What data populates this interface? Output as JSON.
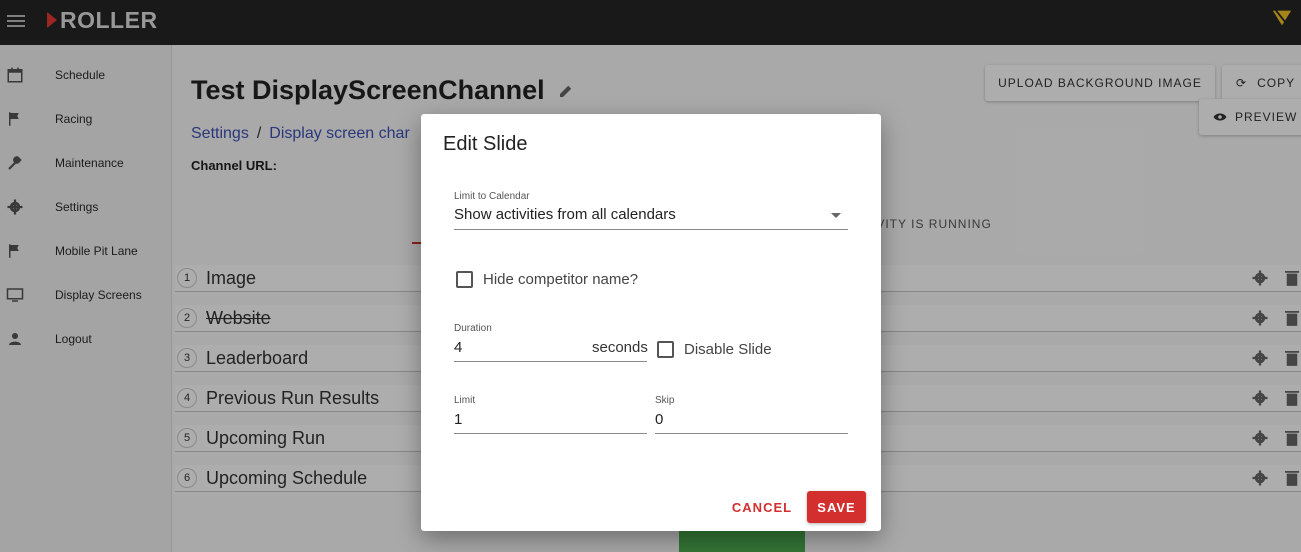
{
  "app": {
    "brand": "ROLLER",
    "accent": "#d32f2f"
  },
  "sidebar": {
    "items": [
      {
        "label": "Schedule",
        "icon": "calendar-icon"
      },
      {
        "label": "Racing",
        "icon": "flag-icon"
      },
      {
        "label": "Maintenance",
        "icon": "wrench-icon"
      },
      {
        "label": "Settings",
        "icon": "gear-icon"
      },
      {
        "label": "Mobile Pit Lane",
        "icon": "flag-icon"
      },
      {
        "label": "Display Screens",
        "icon": "monitor-icon"
      },
      {
        "label": "Logout",
        "icon": "person-icon"
      }
    ]
  },
  "page": {
    "title": "Test DisplayScreenChannel",
    "breadcrumb": {
      "root": "Settings",
      "separator": "/",
      "current": "Display screen char"
    },
    "channel_url_label": "Channel URL:",
    "upload_label": "UPLOAD BACKGROUND IMAGE",
    "copy_label": "COPY",
    "preview_label": "PREVIEW",
    "tab_running": "IVITY IS RUNNING"
  },
  "slides": [
    {
      "num": "1",
      "name": "Image"
    },
    {
      "num": "2",
      "name": "Website",
      "disabled": true
    },
    {
      "num": "3",
      "name": "Leaderboard"
    },
    {
      "num": "4",
      "name": "Previous Run Results"
    },
    {
      "num": "5",
      "name": "Upcoming Run"
    },
    {
      "num": "6",
      "name": "Upcoming Schedule"
    }
  ],
  "dialog": {
    "title": "Edit Slide",
    "calendar_label": "Limit to Calendar",
    "calendar_value": "Show activities from all calendars",
    "hide_competitor_label": "Hide competitor name?",
    "duration_label": "Duration",
    "duration_value": "4",
    "duration_suffix": "seconds",
    "disable_label": "Disable Slide",
    "limit_label": "Limit",
    "limit_value": "1",
    "skip_label": "Skip",
    "skip_value": "0",
    "cancel_label": "CANCEL",
    "save_label": "SAVE"
  }
}
